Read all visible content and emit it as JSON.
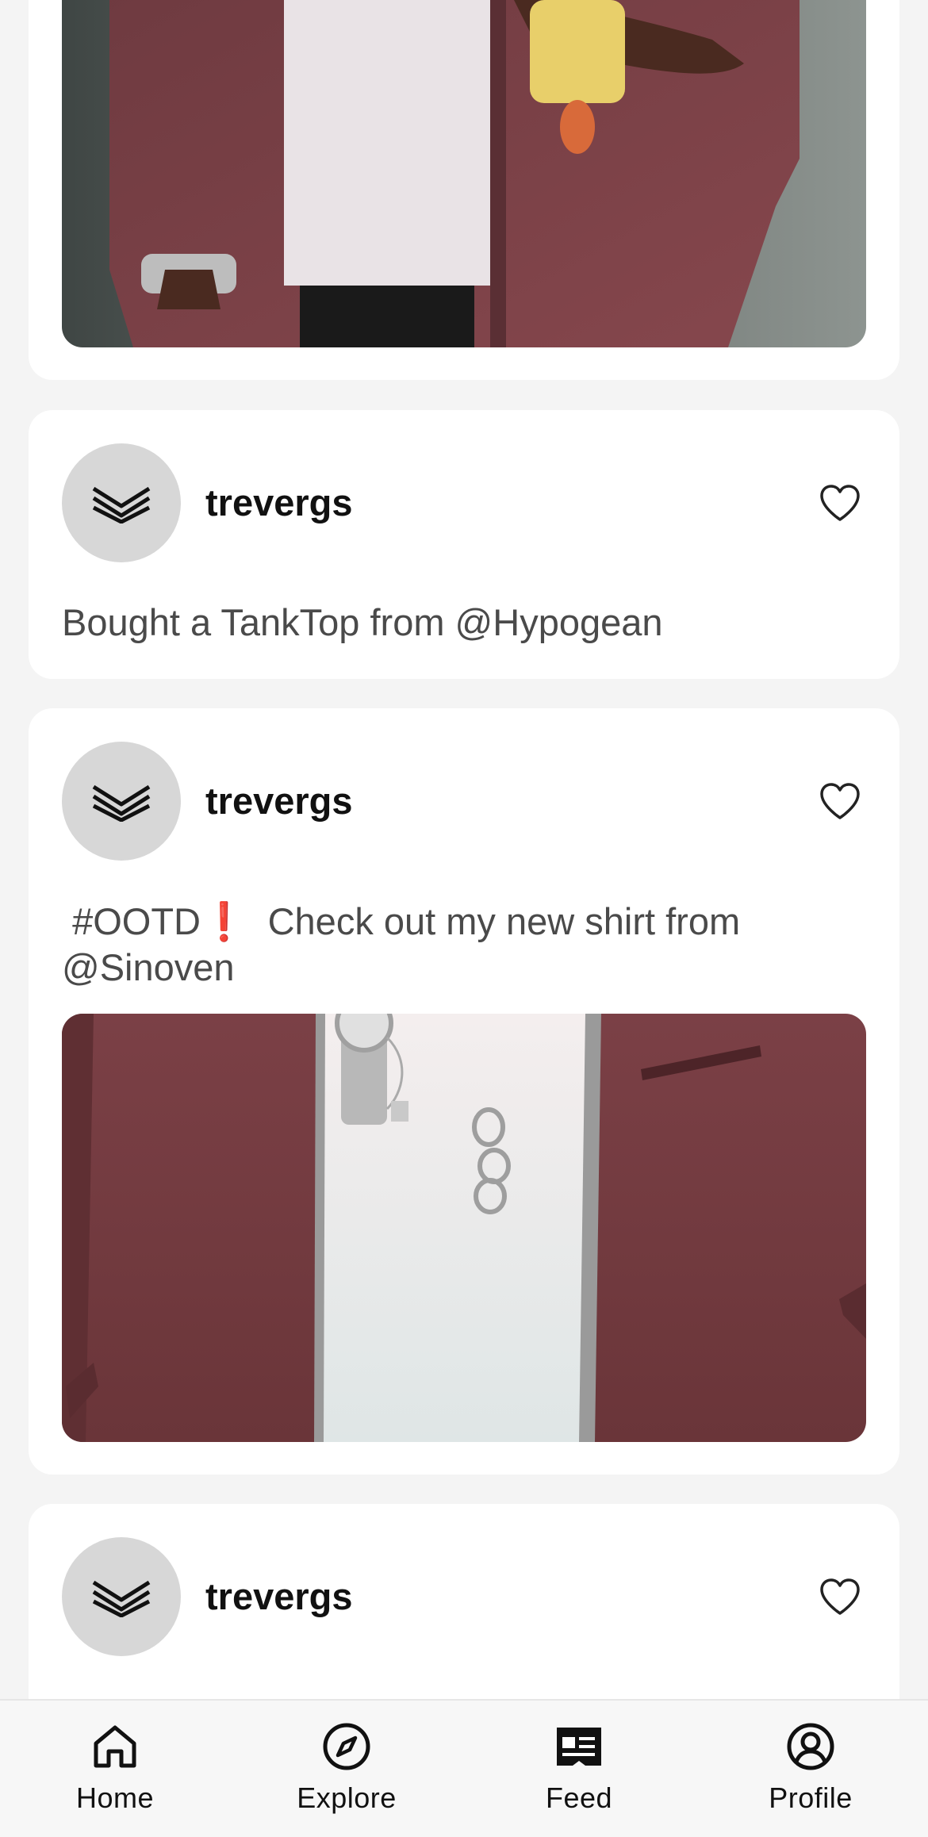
{
  "posts": [
    {
      "type": "photo-only-tail",
      "image": "person-in-maroon-jacket-holding-phone"
    },
    {
      "username": "trevergs",
      "caption": "Bought a TankTop from @Hypogean"
    },
    {
      "username": "trevergs",
      "caption": " #OOTD❗  Check out my new shirt from\n@Sinoven",
      "image": "maroon-jacket-white-shirt-watch-rings"
    },
    {
      "username": "trevergs"
    }
  ],
  "icons": {
    "avatar": "brand-chevrons-icon",
    "like": "heart-outline-icon"
  },
  "nav": {
    "items": [
      {
        "label": "Home",
        "icon": "home-icon"
      },
      {
        "label": "Explore",
        "icon": "compass-icon"
      },
      {
        "label": "Feed",
        "icon": "newspaper-icon"
      },
      {
        "label": "Profile",
        "icon": "user-circle-icon"
      }
    ]
  },
  "colors": {
    "background": "#f4f4f4",
    "card": "#ffffff",
    "avatar_bg": "#d7d7d7",
    "jacket": "#7a3f44",
    "text_primary": "#111111",
    "text_secondary": "#4a4a4a"
  }
}
